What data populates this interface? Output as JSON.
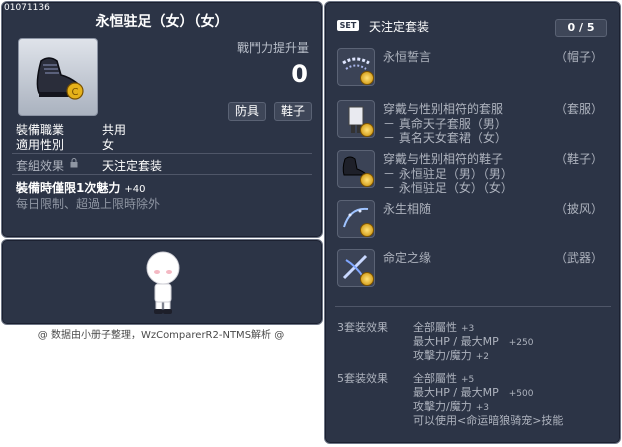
{
  "item": {
    "id": "01071136",
    "title": "永恒驻足（女）（女）",
    "power_label": "戰鬥力提升量",
    "power_value": "0",
    "tags": [
      "防具",
      "鞋子"
    ],
    "job_label": "裝備職業",
    "job_value": "共用",
    "gender_label": "適用性別",
    "gender_value": "女",
    "set_label": "套組效果",
    "set_value": "天注定套装",
    "bonus_label": "裝備時僅限1次魅力",
    "bonus_value": "+40",
    "limit_text": "每日限制、超過上限時除外"
  },
  "credit": "@ 数据由小册子整理，WzComparerR2-NTMS解析 @",
  "set": {
    "badge": "SET",
    "name": "天注定套装",
    "count": "0 / 5",
    "pieces": [
      {
        "name": "永恒誓言",
        "slot": "（帽子）",
        "icon": "hat-icon",
        "sub": []
      },
      {
        "name": "穿戴与性别相符的套服",
        "slot": "（套服）",
        "icon": "suit-icon",
        "sub": [
          "－ 真命天子套服（男）",
          "－ 真名天女套裙（女）"
        ]
      },
      {
        "name": "穿戴与性别相符的鞋子",
        "slot": "（鞋子）",
        "icon": "shoes-icon",
        "sub": [
          "－ 永恒驻足（男）（男）",
          "－ 永恒驻足（女）（女）"
        ]
      },
      {
        "name": "永生相随",
        "slot": "（披风）",
        "icon": "cape-icon",
        "sub": []
      },
      {
        "name": "命定之缘",
        "slot": "（武器）",
        "icon": "weapon-icon",
        "sub": []
      }
    ],
    "effects": [
      {
        "label": "3套装效果",
        "lines": [
          {
            "text": "全部屬性",
            "val": "+3"
          },
          {
            "text": "最大HP / 最大MP",
            "val": "+250"
          },
          {
            "text": "攻擊力/魔力",
            "val": "+2"
          }
        ]
      },
      {
        "label": "5套装效果",
        "lines": [
          {
            "text": "全部屬性",
            "val": "+5"
          },
          {
            "text": "最大HP / 最大MP",
            "val": "+500"
          },
          {
            "text": "攻擊力/魔力",
            "val": "+3"
          },
          {
            "text": "可以使用<命运暗狼骑宠>技能",
            "val": ""
          }
        ]
      }
    ]
  },
  "colors": {
    "panel_bg": "#2c3446",
    "border": "#6d7585",
    "muted": "#aeb3be"
  }
}
